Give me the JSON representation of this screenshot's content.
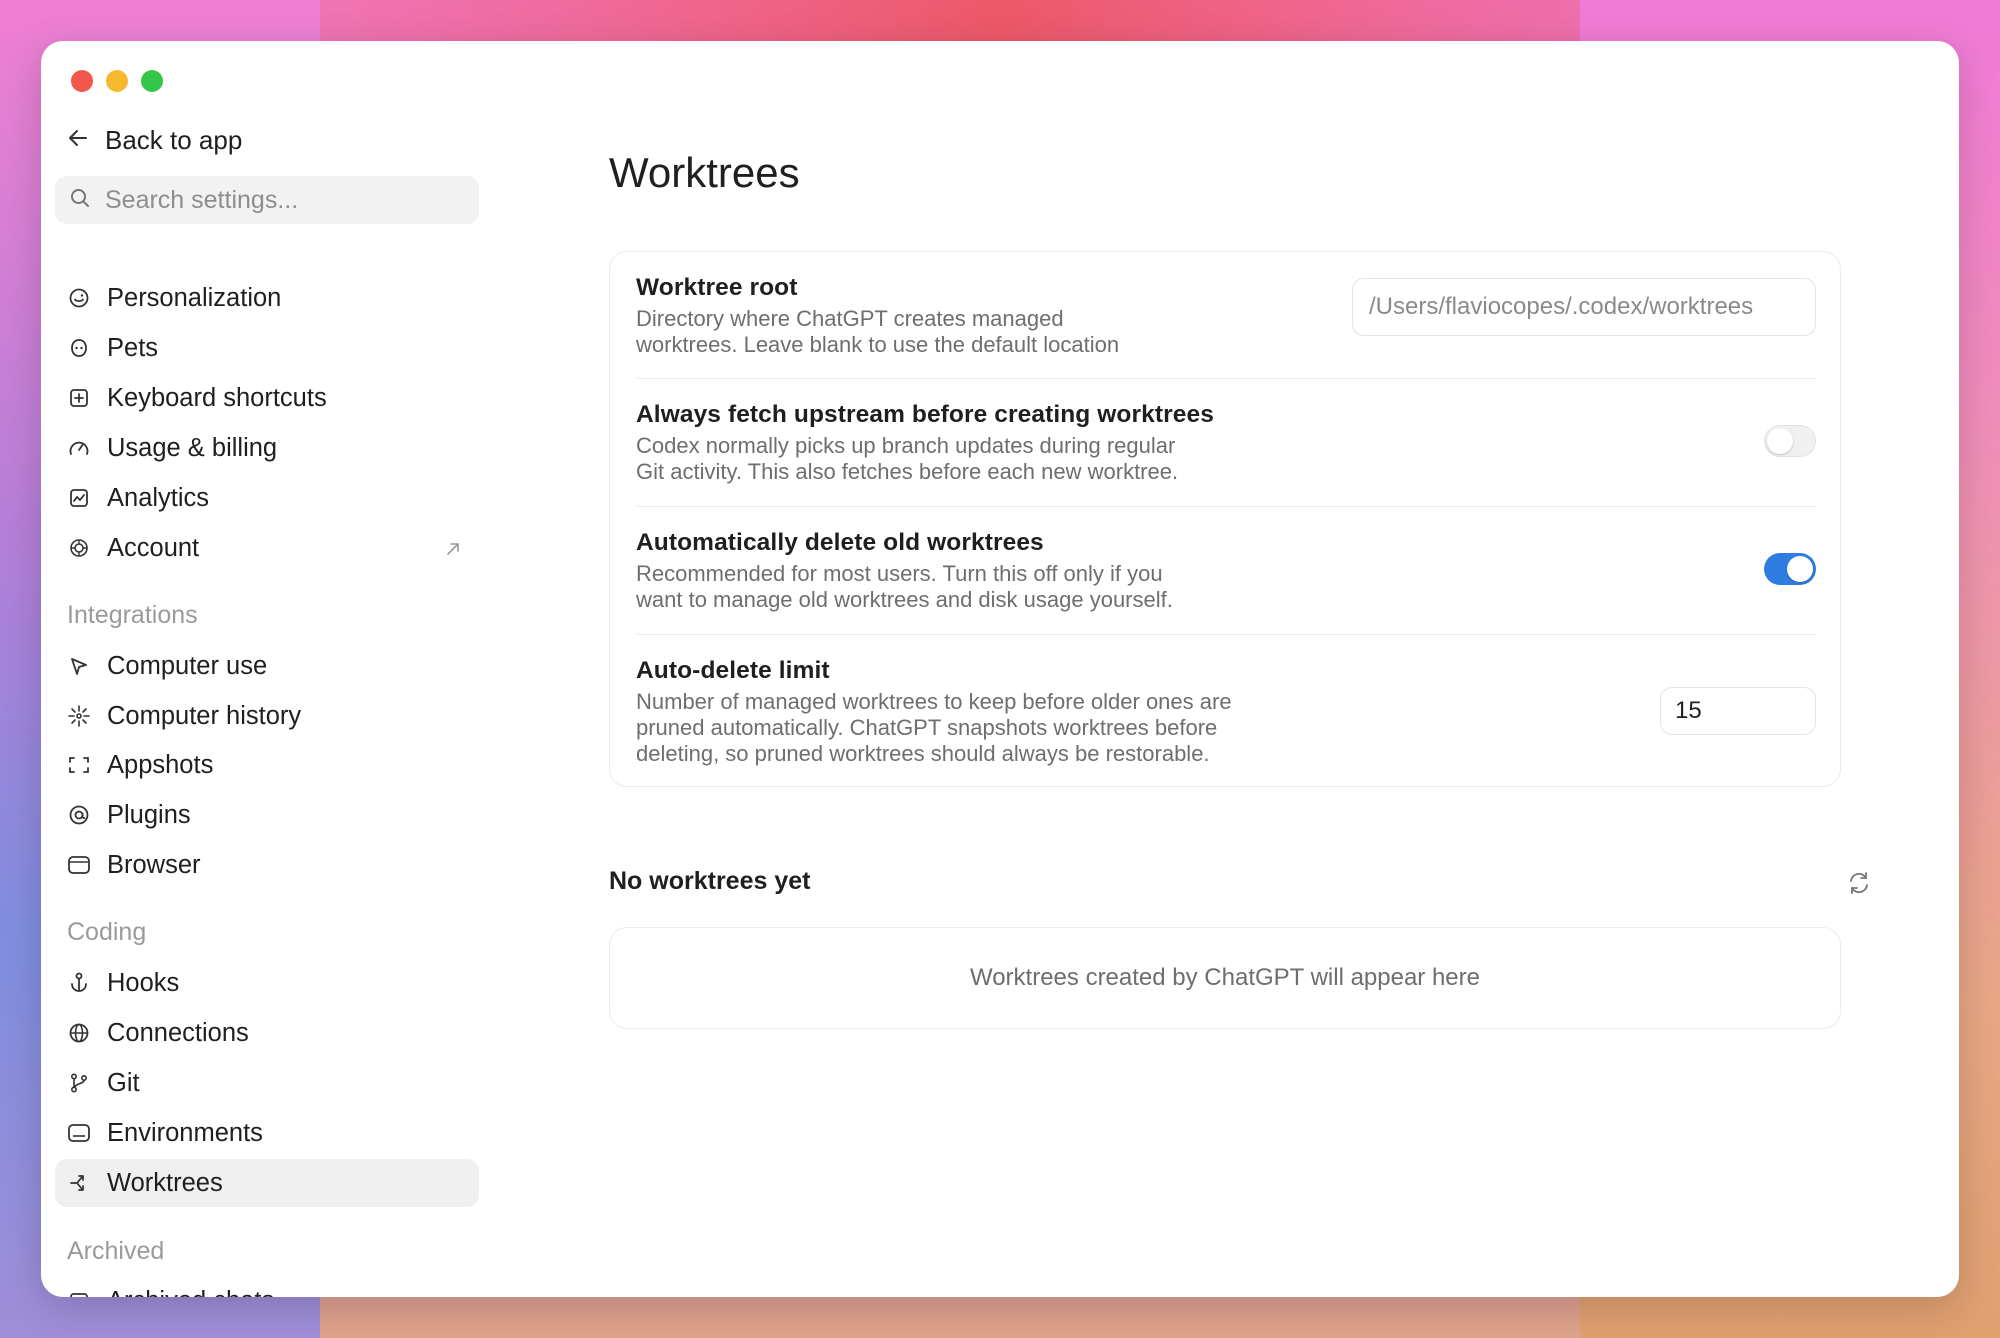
{
  "sidebar": {
    "back_label": "Back to app",
    "search_placeholder": "Search settings...",
    "items_top": [
      {
        "label": "Personalization",
        "icon": "smile-icon"
      },
      {
        "label": "Pets",
        "icon": "pet-icon"
      },
      {
        "label": "Keyboard shortcuts",
        "icon": "keyboard-icon"
      },
      {
        "label": "Usage & billing",
        "icon": "gauge-icon"
      },
      {
        "label": "Analytics",
        "icon": "chart-icon"
      },
      {
        "label": "Account",
        "icon": "openai-icon",
        "external": true
      }
    ],
    "integrations_label": "Integrations",
    "items_integrations": [
      {
        "label": "Computer use",
        "icon": "cursor-icon"
      },
      {
        "label": "Computer history",
        "icon": "sparkle-icon"
      },
      {
        "label": "Appshots",
        "icon": "frame-icon"
      },
      {
        "label": "Plugins",
        "icon": "at-icon"
      },
      {
        "label": "Browser",
        "icon": "browser-icon"
      }
    ],
    "coding_label": "Coding",
    "items_coding": [
      {
        "label": "Hooks",
        "icon": "anchor-icon"
      },
      {
        "label": "Connections",
        "icon": "globe-icon"
      },
      {
        "label": "Git",
        "icon": "git-branch-icon"
      },
      {
        "label": "Environments",
        "icon": "environment-icon"
      },
      {
        "label": "Worktrees",
        "icon": "worktree-icon",
        "active": true
      }
    ],
    "archived_label": "Archived",
    "items_archived": [
      {
        "label": "Archived chats",
        "icon": "archive-icon"
      }
    ]
  },
  "main": {
    "title": "Worktrees",
    "settings": {
      "root": {
        "title": "Worktree root",
        "desc_line1": "Directory where ChatGPT creates managed",
        "desc_line2": "worktrees. Leave blank to use the default location",
        "placeholder": "/Users/flaviocopes/.codex/worktrees"
      },
      "fetch": {
        "title": "Always fetch upstream before creating worktrees",
        "desc_line1": "Codex normally picks up branch updates during regular",
        "desc_line2": "Git activity. This also fetches before each new worktree.",
        "enabled": false
      },
      "auto_delete": {
        "title": "Automatically delete old worktrees",
        "desc_line1": "Recommended for most users. Turn this off only if you",
        "desc_line2": "want to manage old worktrees and disk usage yourself.",
        "enabled": true
      },
      "limit": {
        "title": "Auto-delete limit",
        "desc_line1": "Number of managed worktrees to keep before older ones are",
        "desc_line2": "pruned automatically. ChatGPT snapshots worktrees before",
        "desc_line3": "deleting, so pruned worktrees should always be restorable.",
        "value": "15"
      }
    },
    "list_heading": "No worktrees yet",
    "empty_text": "Worktrees created by ChatGPT will appear here"
  },
  "colors": {
    "accent": "#2f7de1",
    "close": "#f2564d",
    "minimize": "#f6b82c",
    "maximize": "#33c749"
  }
}
